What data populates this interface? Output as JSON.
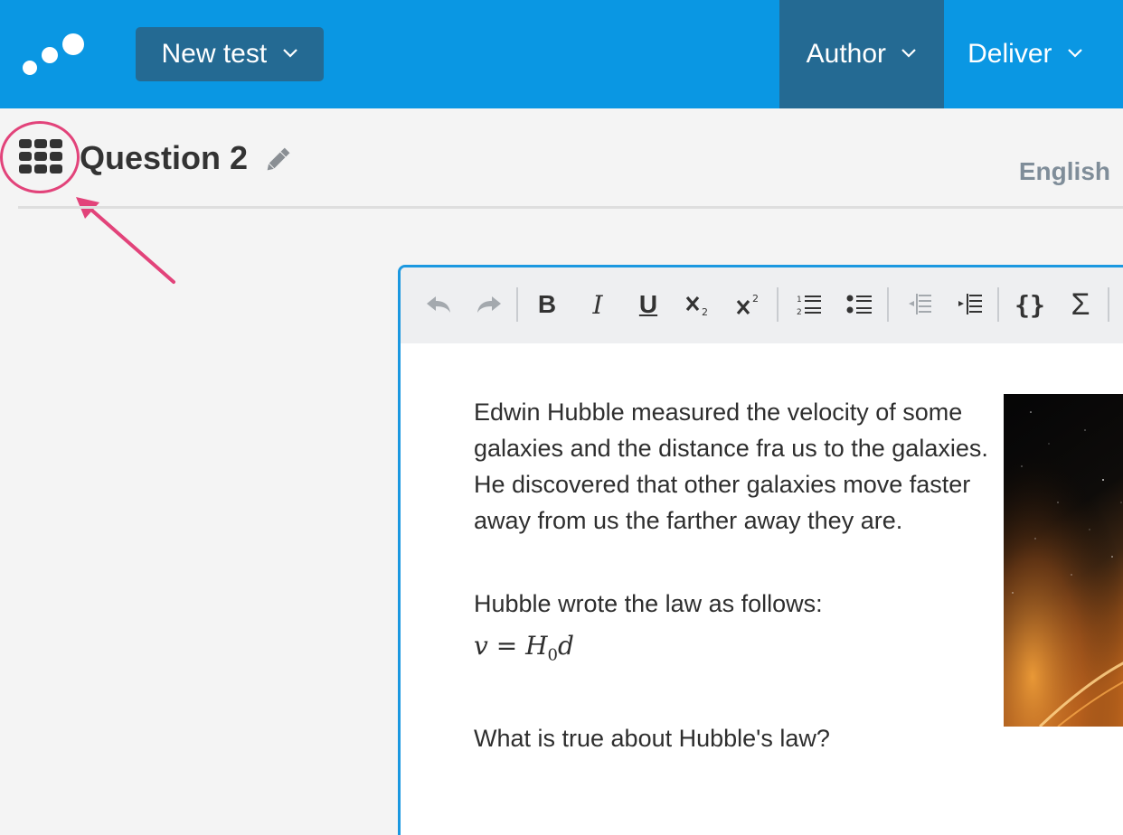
{
  "topbar": {
    "new_test_label": "New test",
    "nav": [
      {
        "label": "Author",
        "active": true
      },
      {
        "label": "Deliver",
        "active": false
      }
    ],
    "colors": {
      "bar": "#0a97e3",
      "active": "#246a93"
    }
  },
  "question": {
    "title": "Question 2",
    "language": "English"
  },
  "editor": {
    "toolbar": [
      {
        "name": "undo",
        "icon": "undo-icon",
        "enabled": false
      },
      {
        "name": "redo",
        "icon": "redo-icon",
        "enabled": false
      },
      {
        "name": "bold",
        "glyph": "B"
      },
      {
        "name": "italic",
        "glyph": "I"
      },
      {
        "name": "underline",
        "glyph": "U"
      },
      {
        "name": "subscript",
        "icon": "subscript-icon"
      },
      {
        "name": "superscript",
        "icon": "superscript-icon"
      },
      {
        "name": "numbered-list",
        "icon": "numbered-list-icon"
      },
      {
        "name": "bullet-list",
        "icon": "bullet-list-icon"
      },
      {
        "name": "outdent",
        "icon": "outdent-icon",
        "enabled": false
      },
      {
        "name": "indent",
        "icon": "indent-icon"
      },
      {
        "name": "code",
        "glyph": "{}"
      },
      {
        "name": "math",
        "glyph": "Σ"
      }
    ],
    "paragraph1": "Edwin Hubble measured the velocity of some galaxies and the distance fra us to the galaxies. He discovered that other galaxies move faster away from us the farther away they are.",
    "paragraph2": "Hubble wrote the law as follows:",
    "formula": {
      "lhs": "v",
      "eq": "=",
      "H": "H",
      "sub": "0",
      "d": "d"
    },
    "paragraph3": "What is true about Hubble's law?",
    "image": "galaxy-image"
  },
  "annotation": {
    "color": "#e2437a"
  }
}
